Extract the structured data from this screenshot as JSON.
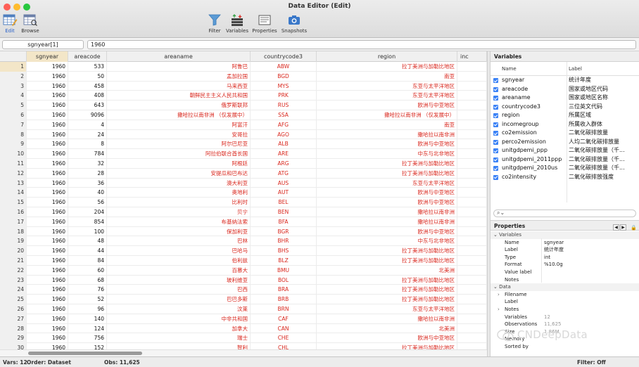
{
  "window": {
    "title": "Data Editor (Edit)"
  },
  "colors": {
    "string_text": "#d9261c",
    "selection": "#f3e6c8",
    "checkbox": "#3b82f6"
  },
  "toolbar_left": [
    {
      "label": "Edit",
      "icon": "edit-grid-icon"
    },
    {
      "label": "Browse",
      "icon": "browse-grid-icon"
    }
  ],
  "toolbar_center": [
    {
      "label": "Filter",
      "icon": "filter-funnel-icon"
    },
    {
      "label": "Variables",
      "icon": "variables-icon"
    },
    {
      "label": "Properties",
      "icon": "properties-icon"
    },
    {
      "label": "Snapshots",
      "icon": "camera-icon"
    }
  ],
  "editbar": {
    "cell_ref": "sgnyear[1]",
    "cell_value": "1960"
  },
  "grid": {
    "columns": [
      "sgnyear",
      "areacode",
      "areaname",
      "countrycode3",
      "region",
      "inc"
    ],
    "rows": [
      [
        "1",
        "1960",
        "533",
        "阿鲁巴",
        "ABW",
        "拉丁美洲与加勒比地区"
      ],
      [
        "2",
        "1960",
        "50",
        "孟加拉国",
        "BGD",
        "南亚"
      ],
      [
        "3",
        "1960",
        "458",
        "马来西亚",
        "MYS",
        "东亚与太平洋地区"
      ],
      [
        "4",
        "1960",
        "408",
        "朝鲜民主主义人民共和国",
        "PRK",
        "东亚与太平洋地区"
      ],
      [
        "5",
        "1960",
        "643",
        "俄罗斯联邦",
        "RUS",
        "欧洲与中亚地区"
      ],
      [
        "6",
        "1960",
        "9096",
        "撒哈拉以南非洲 （仅发展中）",
        "SSA",
        "撒哈拉以南非洲 （仅发展中）"
      ],
      [
        "7",
        "1960",
        "4",
        "阿富汗",
        "AFG",
        "南亚"
      ],
      [
        "8",
        "1960",
        "24",
        "安哥拉",
        "AGO",
        "撒哈拉以南非洲"
      ],
      [
        "9",
        "1960",
        "8",
        "阿尔巴尼亚",
        "ALB",
        "欧洲与中亚地区"
      ],
      [
        "10",
        "1960",
        "784",
        "阿拉伯联合酋长国",
        "ARE",
        "中东与北非地区"
      ],
      [
        "11",
        "1960",
        "32",
        "阿根廷",
        "ARG",
        "拉丁美洲与加勒比地区"
      ],
      [
        "12",
        "1960",
        "28",
        "安提瓜和巴布达",
        "ATG",
        "拉丁美洲与加勒比地区"
      ],
      [
        "13",
        "1960",
        "36",
        "澳大利亚",
        "AUS",
        "东亚与太平洋地区"
      ],
      [
        "14",
        "1960",
        "40",
        "奥地利",
        "AUT",
        "欧洲与中亚地区"
      ],
      [
        "15",
        "1960",
        "56",
        "比利时",
        "BEL",
        "欧洲与中亚地区"
      ],
      [
        "16",
        "1960",
        "204",
        "贝宁",
        "BEN",
        "撒哈拉以南非洲"
      ],
      [
        "17",
        "1960",
        "854",
        "布基纳法索",
        "BFA",
        "撒哈拉以南非洲"
      ],
      [
        "18",
        "1960",
        "100",
        "保加利亚",
        "BGR",
        "欧洲与中亚地区"
      ],
      [
        "19",
        "1960",
        "48",
        "巴林",
        "BHR",
        "中东与北非地区"
      ],
      [
        "20",
        "1960",
        "44",
        "巴哈马",
        "BHS",
        "拉丁美洲与加勒比地区"
      ],
      [
        "21",
        "1960",
        "84",
        "伯利兹",
        "BLZ",
        "拉丁美洲与加勒比地区"
      ],
      [
        "22",
        "1960",
        "60",
        "百慕大",
        "BMU",
        "北美洲"
      ],
      [
        "23",
        "1960",
        "68",
        "玻利维亚",
        "BOL",
        "拉丁美洲与加勒比地区"
      ],
      [
        "24",
        "1960",
        "76",
        "巴西",
        "BRA",
        "拉丁美洲与加勒比地区"
      ],
      [
        "25",
        "1960",
        "52",
        "巴巴多斯",
        "BRB",
        "拉丁美洲与加勒比地区"
      ],
      [
        "26",
        "1960",
        "96",
        "汶莱",
        "BRN",
        "东亚与太平洋地区"
      ],
      [
        "27",
        "1960",
        "140",
        "中非共和国",
        "CAF",
        "撒哈拉以南非洲"
      ],
      [
        "28",
        "1960",
        "124",
        "加拿大",
        "CAN",
        "北美洲"
      ],
      [
        "29",
        "1960",
        "756",
        "瑞士",
        "CHE",
        "欧洲与中亚地区"
      ],
      [
        "30",
        "1960",
        "152",
        "智利",
        "CHL",
        "拉丁美洲与加勒比地区"
      ]
    ]
  },
  "variables_panel": {
    "title": "Variables",
    "col_name": "Name",
    "col_label": "Label",
    "items": [
      {
        "name": "sgnyear",
        "label": "统计年度"
      },
      {
        "name": "areacode",
        "label": "国家或地区代码"
      },
      {
        "name": "areaname",
        "label": "国家或地区名称"
      },
      {
        "name": "countrycode3",
        "label": "三位英文代码"
      },
      {
        "name": "region",
        "label": "所属区域"
      },
      {
        "name": "incomegroup",
        "label": "所属收入群体"
      },
      {
        "name": "co2emission",
        "label": "二氧化碳排放量"
      },
      {
        "name": "perco2emission",
        "label": "人均二氧化碳排放量"
      },
      {
        "name": "unitgdpemi_ppp",
        "label": "二氧化碳排放量（千..."
      },
      {
        "name": "unitgdpemi_2011ppp",
        "label": "二氧化碳排放量（千..."
      },
      {
        "name": "unitgdpemi_2010us",
        "label": "二氧化碳排放量（千..."
      },
      {
        "name": "co2intensity",
        "label": "二氧化碳排放强度"
      }
    ]
  },
  "properties_panel": {
    "title": "Properties",
    "sections": {
      "variables": "Variables",
      "data": "Data"
    },
    "var_props": [
      {
        "key": "Name",
        "value": "sgnyear"
      },
      {
        "key": "Label",
        "value": "统计年度"
      },
      {
        "key": "Type",
        "value": "int"
      },
      {
        "key": "Format",
        "value": "%10.0g"
      },
      {
        "key": "Value label",
        "value": ""
      },
      {
        "key": "Notes",
        "value": ""
      }
    ],
    "data_props": [
      {
        "key": "Filename",
        "value": "",
        "expand": true
      },
      {
        "key": "Label",
        "value": "",
        "expand": false
      },
      {
        "key": "Notes",
        "value": "",
        "expand": true
      },
      {
        "key": "Variables",
        "value": "12",
        "expand": false
      },
      {
        "key": "Observations",
        "value": "11,625",
        "expand": false
      },
      {
        "key": "Size",
        "value": "1.86M",
        "expand": false
      },
      {
        "key": "Memory",
        "value": "",
        "expand": false
      },
      {
        "key": "Sorted by",
        "value": "",
        "expand": false
      }
    ]
  },
  "watermark": "CNDeepData",
  "status": {
    "vars": "Vars: 12",
    "order": "Order: Dataset",
    "obs": "Obs: 11,625",
    "filter": "Filter: Off"
  }
}
